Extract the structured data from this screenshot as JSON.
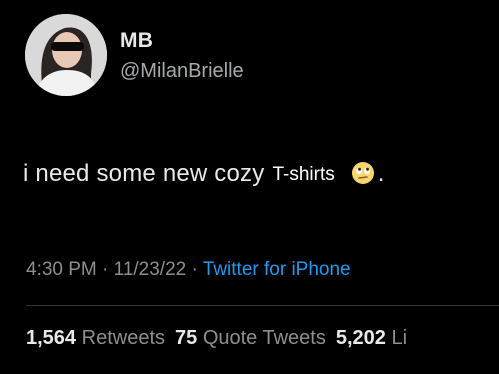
{
  "author": {
    "name": "MB",
    "handle": "@MilanBrielle"
  },
  "tweet": {
    "text_main": "i need some new cozy",
    "text_overlay": "T-shirts",
    "emoji": "eye-roll-emoji",
    "end_punct": "."
  },
  "meta": {
    "time": "4:30 PM",
    "sep1": " · ",
    "date": "11/23/22",
    "sep2": " · ",
    "source": "Twitter for iPhone"
  },
  "stats": {
    "retweets_count": "1,564",
    "retweets_label": "Retweets",
    "quotes_count": "75",
    "quotes_label": "Quote Tweets",
    "likes_count": "5,202",
    "likes_label": "Li"
  },
  "colors": {
    "background": "#000000",
    "link": "#1d9bf0",
    "muted": "#8b8f93"
  }
}
